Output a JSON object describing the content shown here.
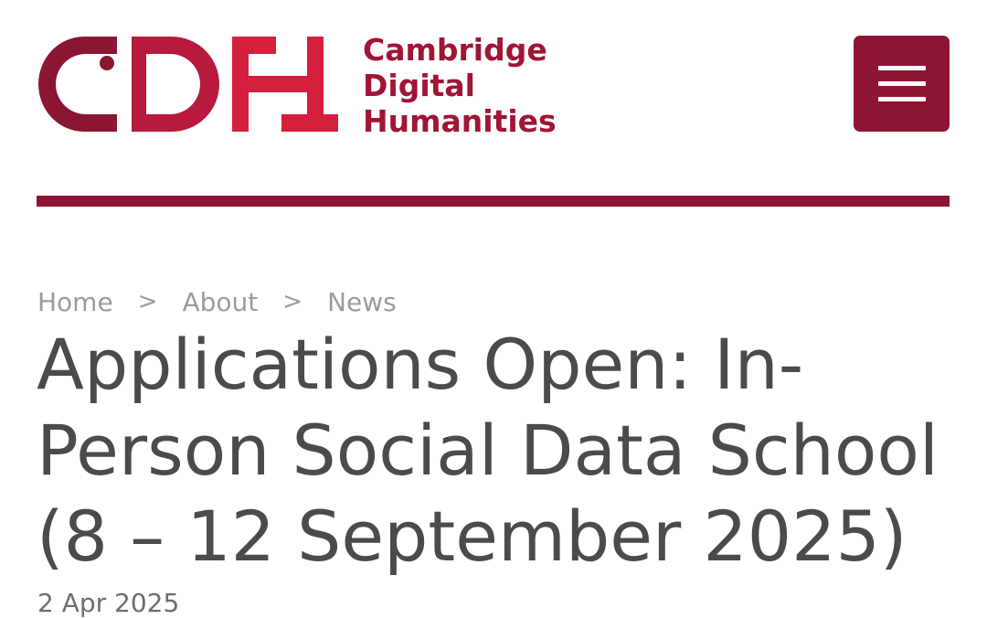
{
  "site": {
    "logo_line1": "Cambridge",
    "logo_line2": "Digital",
    "logo_line3": "Humanities",
    "brand_color": "#8e1433",
    "logo_color": "#a01535"
  },
  "header": {
    "menu_icon": "hamburger-menu-icon",
    "menu_label": "Menu"
  },
  "breadcrumb": {
    "items": [
      "Home",
      "About",
      "News"
    ],
    "separator": ">"
  },
  "article": {
    "title": "Applications Open: In-Person Social Data School (8 – 12 September 2025)",
    "date": "2 Apr 2025"
  }
}
